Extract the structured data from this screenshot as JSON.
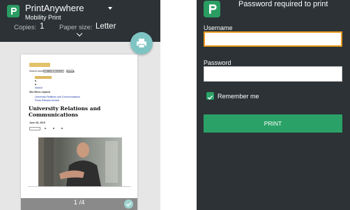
{
  "left": {
    "app_title": "PrintAnywhere",
    "printer_name": "Mobility Print",
    "copies_label": "Copies:",
    "copies_value": "1",
    "paper_label": "Paper size:",
    "paper_value": "Letter",
    "page_indicator": "1 /4",
    "preview": {
      "search_text": "Search:search pages & people",
      "search_button": "Search",
      "search_link": "Search",
      "news_heading": "Site Menu expand",
      "links": [
        "University Relations and Communications",
        "Press Release Archive"
      ],
      "article_title": "University Relations and Communications",
      "article_date": "June 28, 2019"
    }
  },
  "right": {
    "title": "Password required to print",
    "username_label": "Username",
    "username_value": "",
    "password_label": "Password",
    "password_value": "",
    "remember_label": "Remember me",
    "remember_checked": true,
    "print_button": "PRINT"
  },
  "icons": {
    "app": "papercut-p-icon",
    "fab": "printer-icon",
    "dropdown": "caret-down-icon",
    "check": "check-icon"
  },
  "colors": {
    "header": "#2c3236",
    "accent_green": "#2aa267",
    "focus_orange": "#e79a1f",
    "fab": "#7ec4c3"
  }
}
